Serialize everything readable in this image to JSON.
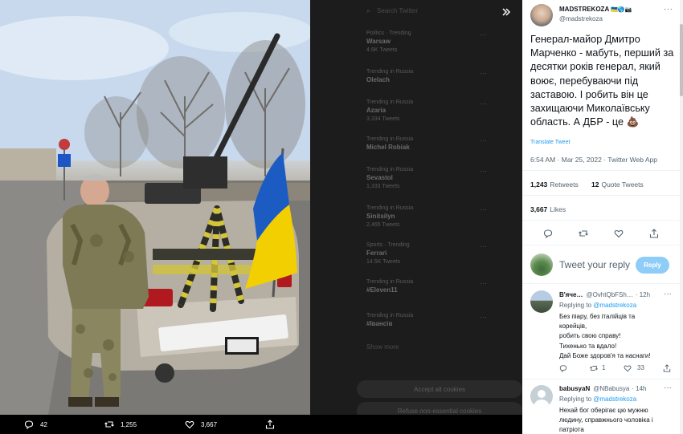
{
  "tweet": {
    "author_name": "MADSTREKOZA",
    "author_handle": "@madstrekoza",
    "author_flags": "🇺🇦🌎📷",
    "text": "Генерал-майор Дмитро Марченко - мабуть, перший за десятки років генерал, який воює, перебуваючи під заставою. І робить він це захищаючи Миколаївську область. А ДБР - це 💩",
    "translate_label": "Translate Tweet",
    "timestamp": "6:54 AM · Mar 25, 2022 · Twitter Web App",
    "retweets_count": "1,243",
    "retweets_label": "Retweets",
    "quotes_count": "12",
    "quotes_label": "Quote Tweets",
    "likes_count": "3,667",
    "likes_label": "Likes"
  },
  "reply_box": {
    "placeholder": "Tweet your reply",
    "button": "Reply"
  },
  "replies": [
    {
      "name": "В'яче…",
      "handle": "@OvhtQbFSh…",
      "time": "· 12h",
      "replying_prefix": "Replying to",
      "replying_to": "@madstrekoza",
      "lines": [
        "Без піару, без італійців та",
        "корейців,",
        "робить свою справу!",
        "Тихенько та вдало!",
        "Дай Боже здоров'я та наснаги!"
      ],
      "retweets": "1",
      "likes": "33"
    },
    {
      "name": "babusyaN",
      "handle": "@NBabusya",
      "time": "· 14h",
      "replying_prefix": "Replying to",
      "replying_to": "@madstrekoza",
      "lines": [
        "Нехай бог оберігає цю мужню",
        "людину, справжнього чоловіка і",
        "патріота"
      ]
    }
  ],
  "media_actions": {
    "replies": "42",
    "retweets": "1,255",
    "likes": "3,667"
  },
  "photo": {
    "car_plate_text": "русский военный корабль, иди на хуй"
  },
  "background": {
    "search_placeholder": "Search Twitter",
    "trends": [
      {
        "cap": "Politics · Trending",
        "name": "Warsaw",
        "count": "4.6K Tweets"
      },
      {
        "cap": "Trending in Russia",
        "name": "Olelach",
        "count": ""
      },
      {
        "cap": "Trending in Russia",
        "name": "Azaria",
        "count": "3,334 Tweets"
      },
      {
        "cap": "Trending in Russia",
        "name": "Michel Robiak",
        "count": ""
      },
      {
        "cap": "Trending in Russia",
        "name": "Sevastol",
        "count": "1,333 Tweets"
      },
      {
        "cap": "Trending in Russia",
        "name": "Sinitsilyn",
        "count": "2,465 Tweets"
      },
      {
        "cap": "Sports · Trending",
        "name": "Ferrari",
        "count": "14.5K Tweets"
      },
      {
        "cap": "Trending in Russia",
        "name": "#Eleven11",
        "count": ""
      },
      {
        "cap": "Trending in Russia",
        "name": "#Iвансів",
        "count": ""
      }
    ],
    "show_more": "Show more",
    "cookie_accept": "Accept all cookies",
    "cookie_refuse": "Refuse non-essential cookies"
  }
}
